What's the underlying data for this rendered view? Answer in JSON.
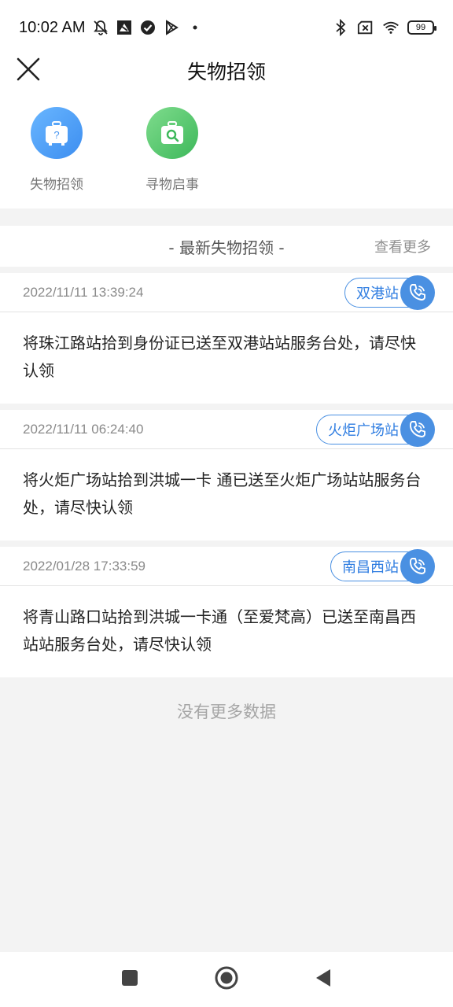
{
  "status_bar": {
    "time": "10:02 AM",
    "left_icons": [
      "muted-bell-icon",
      "app-icon",
      "check-circle-icon",
      "play-store-icon",
      "dot-icon"
    ],
    "right_icons": [
      "bluetooth-icon",
      "no-sim-icon",
      "wifi-icon"
    ],
    "battery": "99"
  },
  "header": {
    "title": "失物招领"
  },
  "quick_actions": [
    {
      "label": "失物招领",
      "icon": "lost-luggage-icon",
      "color": "#4a96f0"
    },
    {
      "label": "寻物启事",
      "icon": "search-bag-icon",
      "color": "#4cc46a"
    }
  ],
  "section": {
    "title": "- 最新失物招领 -",
    "more": "查看更多"
  },
  "items": [
    {
      "time": "2022/11/11 13:39:24",
      "station": "双港站",
      "text": "将珠江路站拾到身份证已送至双港站站服务台处，请尽快认领"
    },
    {
      "time": "2022/11/11 06:24:40",
      "station": "火炬广场站",
      "text": "将火炬广场站拾到洪城一卡 通已送至火炬广场站站服务台处，请尽快认领"
    },
    {
      "time": "2022/01/28 17:33:59",
      "station": "南昌西站",
      "text": "将青山路口站拾到洪城一卡通（至爱梵高）已送至南昌西站站服务台处，请尽快认领"
    }
  ],
  "footer": {
    "no_more": "没有更多数据"
  },
  "colors": {
    "accent": "#4a90e2",
    "background": "#f3f3f3"
  }
}
